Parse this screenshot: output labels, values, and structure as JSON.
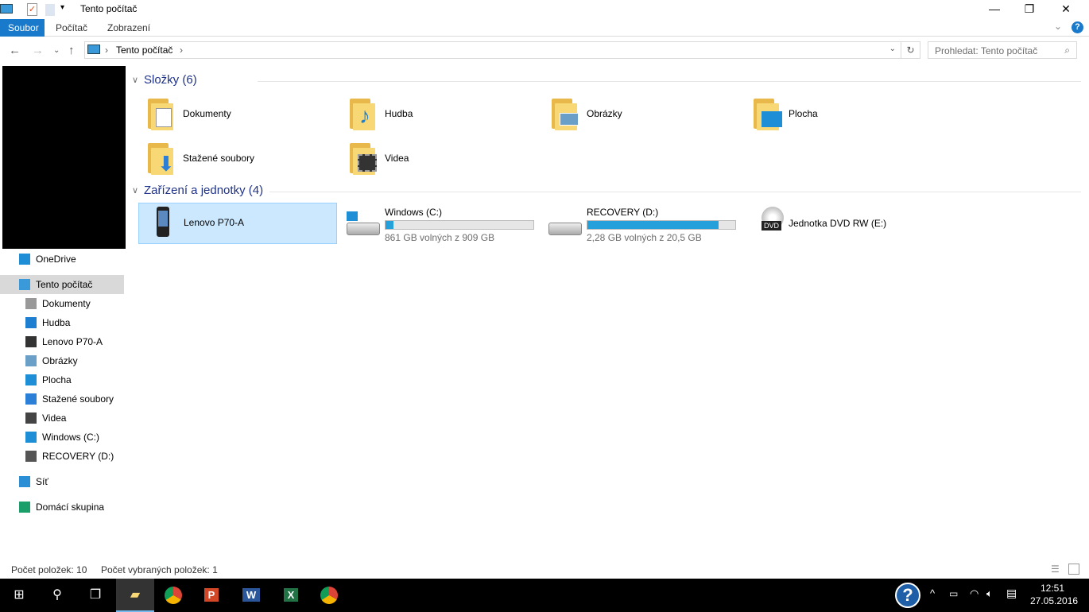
{
  "window": {
    "title": "Tento počítač",
    "minimize": "—",
    "restore": "❐",
    "close": "✕"
  },
  "ribbon": {
    "tabs": [
      "Soubor",
      "Počítač",
      "Zobrazení"
    ],
    "help": "?",
    "expand": "⌄"
  },
  "address": {
    "path": "Tento počítač",
    "search_placeholder": "Prohledat: Tento počítač"
  },
  "nav": {
    "items": [
      {
        "label": "OneDrive",
        "icon": "onedrive-icon",
        "color": "#1e8fd6"
      },
      {
        "label": "Tento počítač",
        "icon": "computer-icon",
        "color": "#3a9ad9"
      },
      {
        "label": "Dokumenty",
        "icon": "documents-icon",
        "color": "#999999"
      },
      {
        "label": "Hudba",
        "icon": "music-icon",
        "color": "#1e7fd0"
      },
      {
        "label": "Lenovo P70-A",
        "icon": "phone-icon",
        "color": "#333333"
      },
      {
        "label": "Obrázky",
        "icon": "pictures-icon",
        "color": "#6aa0c8"
      },
      {
        "label": "Plocha",
        "icon": "desktop-icon",
        "color": "#1e8fd6"
      },
      {
        "label": "Stažené soubory",
        "icon": "download-icon",
        "color": "#2b7fd6"
      },
      {
        "label": "Videa",
        "icon": "videos-icon",
        "color": "#444444"
      },
      {
        "label": "Windows (C:)",
        "icon": "drive-icon",
        "color": "#1e8fd6"
      },
      {
        "label": "RECOVERY (D:)",
        "icon": "drive-icon",
        "color": "#555555"
      },
      {
        "label": "Síť",
        "icon": "network-icon",
        "color": "#2b8fd6"
      },
      {
        "label": "Domácí skupina",
        "icon": "homegroup-icon",
        "color": "#1a9f6a"
      }
    ]
  },
  "folders": {
    "title": "Složky",
    "count": "(6)",
    "items": [
      {
        "label": "Dokumenty",
        "icon": "documents-folder-icon"
      },
      {
        "label": "Hudba",
        "icon": "music-folder-icon"
      },
      {
        "label": "Obrázky",
        "icon": "pictures-folder-icon"
      },
      {
        "label": "Plocha",
        "icon": "desktop-folder-icon"
      },
      {
        "label": "Stažené soubory",
        "icon": "downloads-folder-icon"
      },
      {
        "label": "Videa",
        "icon": "videos-folder-icon"
      }
    ]
  },
  "devices": {
    "title": "Zařízení a jednotky",
    "count": "(4)",
    "items": [
      {
        "label": "Lenovo P70-A",
        "icon": "phone-icon"
      },
      {
        "label": "Windows (C:)",
        "free": "861 GB volných z 909 GB",
        "used_fraction": 0.053
      },
      {
        "label": "RECOVERY (D:)",
        "free": "2,28 GB volných z 20,5 GB",
        "used_fraction": 0.889
      },
      {
        "label": "Jednotka DVD RW (E:)",
        "icon": "dvd-icon",
        "badge": "DVD"
      }
    ]
  },
  "status": {
    "items": "Počet položek: 10",
    "selected": "Počet vybraných položek: 1"
  },
  "taskbar": {
    "time": "12:51",
    "date": "27.05.2016"
  }
}
